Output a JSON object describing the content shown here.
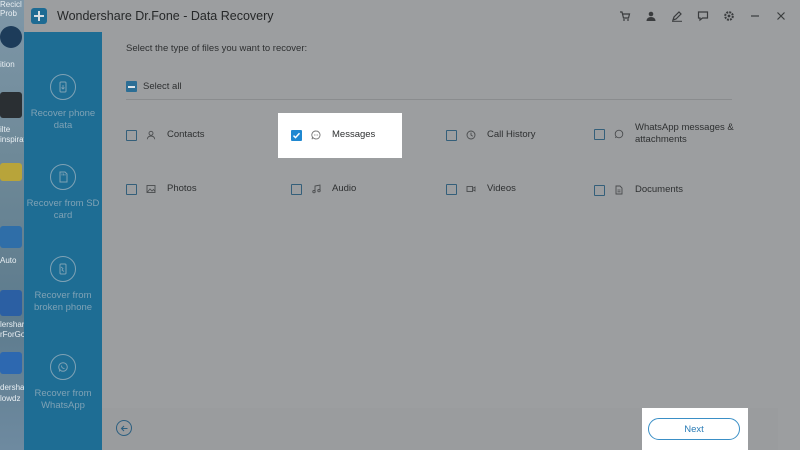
{
  "desktop": {
    "labels": [
      "Recicl",
      "Prob",
      "ition",
      "ilte",
      "inspiratio",
      "Auto",
      "lershar",
      "rForGo",
      "dershar",
      "lowdz"
    ]
  },
  "window": {
    "title": "Wondershare Dr.Fone - Data Recovery"
  },
  "titlebar_icons": [
    "cart-icon",
    "user-icon",
    "edit-icon",
    "feedback-icon",
    "settings-icon",
    "minimize-icon",
    "close-icon"
  ],
  "sidebar": {
    "items": [
      {
        "label": "Recover phone data",
        "icon": "phone-data-icon"
      },
      {
        "label": "Recover from SD card",
        "icon": "sd-card-icon"
      },
      {
        "label": "Recover from broken phone",
        "icon": "broken-phone-icon"
      },
      {
        "label": "Recover from WhatsApp",
        "icon": "whatsapp-icon"
      }
    ]
  },
  "main": {
    "prompt": "Select the type of files you want to recover:",
    "select_all": "Select all",
    "options": [
      {
        "label": "Contacts",
        "icon": "contact-icon",
        "checked": false
      },
      {
        "label": "Messages",
        "icon": "message-icon",
        "checked": true
      },
      {
        "label": "Call History",
        "icon": "clock-icon",
        "checked": false
      },
      {
        "label": "WhatsApp messages & attachments",
        "icon": "whatsapp-icon",
        "checked": false
      },
      {
        "label": "Photos",
        "icon": "photo-icon",
        "checked": false
      },
      {
        "label": "Audio",
        "icon": "music-icon",
        "checked": false
      },
      {
        "label": "Videos",
        "icon": "video-icon",
        "checked": false
      },
      {
        "label": "Documents",
        "icon": "document-icon",
        "checked": false
      }
    ]
  },
  "footer": {
    "next_label": "Next"
  },
  "colors": {
    "sidebar": "#1e6d94",
    "accent": "#1f88d1",
    "overlay": "#9c9ea0"
  }
}
